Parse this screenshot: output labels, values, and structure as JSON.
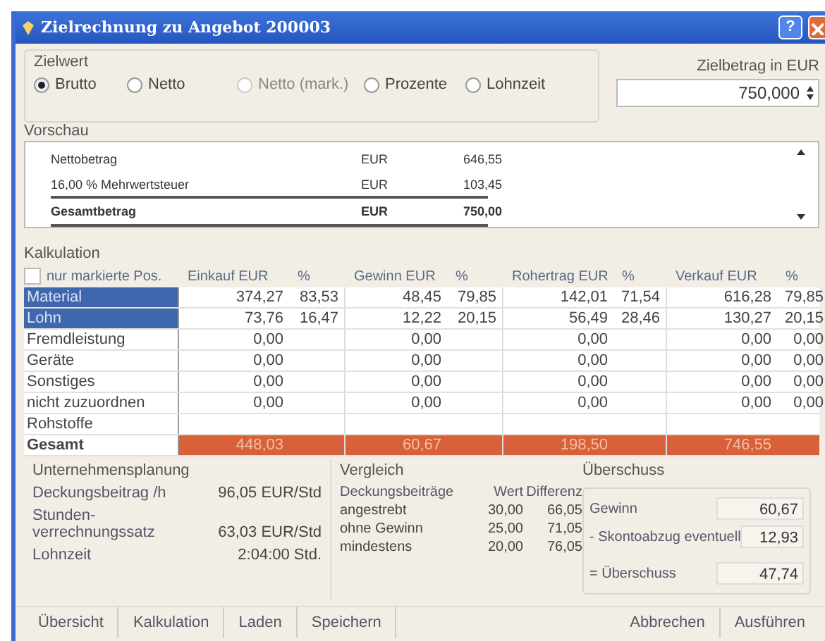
{
  "window": {
    "title": "Zielrechnung zu Angebot 200003",
    "help": "?"
  },
  "zielwert": {
    "label": "Zielwert",
    "options": [
      {
        "label": "Brutto",
        "selected": true
      },
      {
        "label": "Netto",
        "selected": false
      },
      {
        "label": "Netto (mark.)",
        "selected": false,
        "disabled": true
      },
      {
        "label": "Prozente",
        "selected": false
      },
      {
        "label": "Lohnzeit",
        "selected": false
      }
    ],
    "amount": {
      "label": "Zielbetrag in EUR",
      "value": "750,000"
    }
  },
  "vorschau": {
    "label": "Vorschau",
    "rows": [
      {
        "kind": "line",
        "label": "Nettobetrag",
        "currency": "EUR",
        "amount": "646,55"
      },
      {
        "kind": "line",
        "label": "16,00 % Mehrwertsteuer",
        "currency": "EUR",
        "amount": "103,45"
      },
      {
        "kind": "total",
        "label": "Gesamtbetrag",
        "currency": "EUR",
        "amount": "750,00"
      }
    ]
  },
  "kalkulation": {
    "label": "Kalkulation",
    "filter": {
      "label": "nur markierte Pos.",
      "checked": false
    },
    "columns": [
      "Einkauf EUR",
      "%",
      "Gewinn EUR",
      "%",
      "Rohertrag EUR",
      "%",
      "Verkauf EUR",
      "%"
    ],
    "rows": [
      {
        "kind": "item",
        "name": "Material",
        "selected": true,
        "values": {
          "einkauf": "374,27",
          "einkauf_pct": "83,53",
          "gewinn": "48,45",
          "gewinn_pct": "79,85",
          "rohertrag": "142,01",
          "rohertrag_pct": "71,54",
          "verkauf": "616,28",
          "verkauf_pct": "79,85"
        }
      },
      {
        "kind": "item",
        "name": "Lohn",
        "selected": true,
        "values": {
          "einkauf": "73,76",
          "einkauf_pct": "16,47",
          "gewinn": "12,22",
          "gewinn_pct": "20,15",
          "rohertrag": "56,49",
          "rohertrag_pct": "28,46",
          "verkauf": "130,27",
          "verkauf_pct": "20,15"
        }
      },
      {
        "kind": "item",
        "name": "Fremdleistung",
        "selected": false,
        "values": {
          "einkauf": "0,00",
          "gewinn": "0,00",
          "rohertrag": "0,00",
          "verkauf": "0,00",
          "verkauf_pct": "0,00"
        }
      },
      {
        "kind": "item",
        "name": "Geräte",
        "selected": false,
        "values": {
          "einkauf": "0,00",
          "gewinn": "0,00",
          "rohertrag": "0,00",
          "verkauf": "0,00",
          "verkauf_pct": "0,00"
        }
      },
      {
        "kind": "item",
        "name": "Sonstiges",
        "selected": false,
        "values": {
          "einkauf": "0,00",
          "gewinn": "0,00",
          "rohertrag": "0,00",
          "verkauf": "0,00",
          "verkauf_pct": "0,00"
        }
      },
      {
        "kind": "item",
        "name": "nicht zuzuordnen",
        "selected": false,
        "values": {
          "einkauf": "0,00",
          "gewinn": "0,00",
          "rohertrag": "0,00",
          "verkauf": "0,00",
          "verkauf_pct": "0,00"
        }
      },
      {
        "kind": "item",
        "name": "Rohstoffe",
        "selected": false,
        "values": {}
      },
      {
        "kind": "total",
        "name": "Gesamt",
        "selected": false,
        "values": {
          "einkauf": "448,03",
          "gewinn": "60,67",
          "rohertrag": "198,50",
          "verkauf": "746,55"
        }
      }
    ]
  },
  "unternehmensplanung": {
    "label": "Unternehmensplanung",
    "rows": [
      {
        "label": "Deckungsbeitrag /h",
        "value": "96,05 EUR/Std"
      },
      {
        "label": "Stunden-verrechnungssatz",
        "value": "63,03 EUR/Std"
      },
      {
        "label": "Lohnzeit",
        "value": "2:04:00 Std."
      }
    ]
  },
  "vergleich": {
    "label": "Vergleich",
    "headers": [
      "Deckungsbeiträge",
      "Wert",
      "Differenz"
    ],
    "rows": [
      {
        "label": "angestrebt",
        "wert": "30,00",
        "differenz": "66,05"
      },
      {
        "label": "ohne Gewinn",
        "wert": "25,00",
        "differenz": "71,05"
      },
      {
        "label": "mindestens",
        "wert": "20,00",
        "differenz": "76,05"
      }
    ]
  },
  "ueberschuss": {
    "label": "Überschuss",
    "rows": [
      {
        "label": "Gewinn",
        "value": "60,67"
      },
      {
        "label": "- Skontoabzug eventuell",
        "value": "12,93"
      },
      {
        "label": "= Überschuss",
        "value": "47,74"
      }
    ]
  },
  "buttons_left": [
    "Übersicht",
    "Kalkulation",
    "Laden",
    "Speichern"
  ],
  "buttons_right": [
    "Abbrechen",
    "Ausführen"
  ]
}
